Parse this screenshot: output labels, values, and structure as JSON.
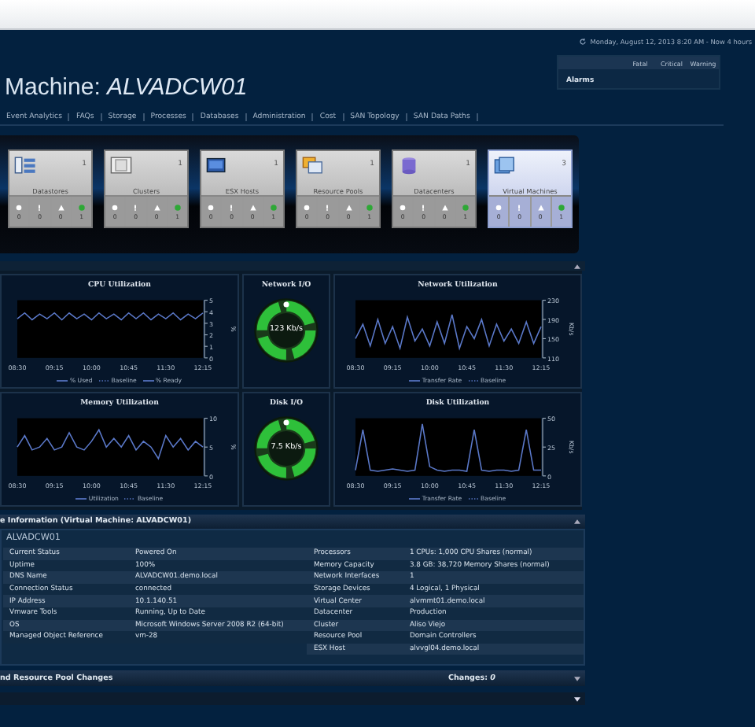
{
  "date_range": "Monday, August 12, 2013 8:20 AM - Now 4 hours",
  "title": {
    "prefix": "Machine:",
    "name": "ALVADCW01"
  },
  "alarms": {
    "columns": [
      "Fatal",
      "Critical",
      "Warning"
    ],
    "row_label": "Alarms"
  },
  "tabs": [
    {
      "label": "Event Analytics",
      "selected": false
    },
    {
      "label": "FAQs",
      "selected": false
    },
    {
      "label": "Storage",
      "selected": false
    },
    {
      "label": "Processes",
      "selected": false
    },
    {
      "label": "Databases",
      "selected": false
    },
    {
      "label": "Administration",
      "selected": false
    },
    {
      "label": "Cost",
      "selected": false
    },
    {
      "label": "SAN Topology",
      "selected": false
    },
    {
      "label": "SAN Data Paths",
      "selected": false
    }
  ],
  "tiles": [
    {
      "kind": "datastore",
      "label": "Datastores",
      "count": "1",
      "selected": false,
      "statuses": [
        "0",
        "0",
        "0",
        "1"
      ]
    },
    {
      "kind": "cluster",
      "label": "Clusters",
      "count": "1",
      "selected": false,
      "statuses": [
        "0",
        "0",
        "0",
        "1"
      ]
    },
    {
      "kind": "host",
      "label": "ESX Hosts",
      "count": "1",
      "selected": false,
      "statuses": [
        "0",
        "0",
        "0",
        "1"
      ]
    },
    {
      "kind": "pool",
      "label": "Resource Pools",
      "count": "1",
      "selected": false,
      "statuses": [
        "0",
        "0",
        "0",
        "1"
      ]
    },
    {
      "kind": "datacenter",
      "label": "Datacenters",
      "count": "1",
      "selected": false,
      "statuses": [
        "0",
        "0",
        "0",
        "1"
      ]
    },
    {
      "kind": "vm",
      "label": "Virtual Machines",
      "count": "3",
      "selected": true,
      "statuses": [
        "0",
        "0",
        "0",
        "1"
      ]
    }
  ],
  "panels": [
    {
      "kind": "chart",
      "chart_data": {
        "type": "line",
        "title": "CPU Utilization",
        "ylabel": "%",
        "ylim": [
          0,
          5
        ],
        "yticks": [
          0,
          1,
          2,
          3,
          4,
          5
        ],
        "categories": [
          "08:30",
          null,
          null,
          null,
          null,
          "09:15",
          null,
          null,
          null,
          null,
          "10:00",
          null,
          null,
          null,
          null,
          "10:45",
          null,
          null,
          null,
          null,
          "11:30",
          null,
          null,
          null,
          null,
          "12:15"
        ],
        "series": [
          {
            "name": "% Used",
            "color": "#5a78c8",
            "values": [
              3.4,
              3.9,
              3.3,
              3.8,
              3.4,
              3.9,
              3.3,
              3.9,
              3.4,
              3.8,
              3.3,
              3.9,
              3.4,
              3.8,
              3.3,
              3.9,
              3.4,
              3.9,
              3.3,
              3.8,
              3.4,
              3.9,
              3.3,
              3.8,
              3.4,
              3.9
            ]
          },
          {
            "name": "Baseline",
            "color": "#5a78c8",
            "values": [
              null,
              null,
              null,
              null,
              null,
              null,
              null,
              null,
              null,
              null,
              null,
              null,
              null,
              null,
              null,
              null,
              null,
              null,
              null,
              null,
              null,
              null,
              null,
              null,
              null,
              null
            ]
          },
          {
            "name": "% Ready",
            "color": "#5a78c8",
            "values": [
              null,
              null,
              null,
              null,
              null,
              null,
              null,
              null,
              null,
              null,
              null,
              null,
              null,
              null,
              null,
              null,
              null,
              null,
              null,
              null,
              null,
              null,
              null,
              null,
              null,
              null
            ]
          }
        ]
      }
    },
    {
      "kind": "gauge",
      "title": "Network I/O",
      "reading": "123 Kb/s"
    },
    {
      "kind": "chart",
      "chart_data": {
        "type": "line",
        "title": "Network Utilization",
        "ylabel": "Kb/s",
        "ylim": [
          110,
          230
        ],
        "yticks": [
          110,
          150,
          190,
          230
        ],
        "categories": [
          "08:30",
          null,
          null,
          null,
          null,
          "09:15",
          null,
          null,
          null,
          null,
          "10:00",
          null,
          null,
          null,
          null,
          "10:45",
          null,
          null,
          null,
          null,
          "11:30",
          null,
          null,
          null,
          null,
          "12:15"
        ],
        "series": [
          {
            "name": "Transfer Rate",
            "color": "#5a78c8",
            "values": [
              150,
              180,
              135,
              190,
              140,
              175,
              130,
              195,
              145,
              170,
              135,
              185,
              140,
              200,
              130,
              175,
              150,
              190,
              135,
              180,
              145,
              170,
              140,
              185,
              140,
              175
            ]
          },
          {
            "name": "Baseline",
            "color": "#5a78c8",
            "values": [
              null,
              null,
              null,
              null,
              null,
              null,
              null,
              null,
              null,
              null,
              null,
              null,
              null,
              null,
              null,
              null,
              null,
              null,
              null,
              null,
              null,
              null,
              null,
              null,
              null,
              null
            ]
          }
        ]
      }
    },
    {
      "kind": "chart",
      "chart_data": {
        "type": "line",
        "title": "Memory Utilization",
        "ylabel": "%",
        "ylim": [
          0,
          10
        ],
        "yticks": [
          0,
          5,
          10
        ],
        "categories": [
          "08:30",
          null,
          null,
          null,
          null,
          "09:15",
          null,
          null,
          null,
          null,
          "10:00",
          null,
          null,
          null,
          null,
          "10:45",
          null,
          null,
          null,
          null,
          "11:30",
          null,
          null,
          null,
          null,
          "12:15"
        ],
        "series": [
          {
            "name": "Utilization",
            "color": "#5a78c8",
            "values": [
              5,
              7,
              4.5,
              5,
              6.5,
              4.5,
              5,
              7.5,
              5,
              4.5,
              6,
              8,
              5,
              6.5,
              5,
              7,
              4.5,
              6,
              5,
              3,
              7,
              5,
              6.5,
              4.5,
              6,
              5
            ]
          },
          {
            "name": "Baseline",
            "color": "#5a78c8",
            "values": [
              null,
              null,
              null,
              null,
              null,
              null,
              null,
              null,
              null,
              null,
              null,
              null,
              null,
              null,
              null,
              null,
              null,
              null,
              null,
              null,
              null,
              null,
              null,
              null,
              null,
              null
            ]
          }
        ]
      }
    },
    {
      "kind": "gauge",
      "title": "Disk I/O",
      "reading": "7.5 Kb/s"
    },
    {
      "kind": "chart",
      "chart_data": {
        "type": "line",
        "title": "Disk Utilization",
        "ylabel": "Kb/s",
        "ylim": [
          0,
          50
        ],
        "yticks": [
          0,
          25,
          50
        ],
        "categories": [
          "08:30",
          null,
          null,
          null,
          null,
          "09:15",
          null,
          null,
          null,
          null,
          "10:00",
          null,
          null,
          null,
          null,
          "10:45",
          null,
          null,
          null,
          null,
          "11:30",
          null,
          null,
          null,
          null,
          "12:15"
        ],
        "series": [
          {
            "name": "Transfer Rate",
            "color": "#5a78c8",
            "values": [
              5,
              40,
              5,
              4,
              5,
              6,
              5,
              4,
              5,
              45,
              8,
              5,
              4,
              5,
              5,
              4,
              40,
              5,
              4,
              5,
              5,
              4,
              5,
              40,
              5,
              5
            ]
          },
          {
            "name": "Baseline",
            "color": "#5a78c8",
            "values": [
              null,
              null,
              null,
              null,
              null,
              null,
              null,
              null,
              null,
              null,
              null,
              null,
              null,
              null,
              null,
              null,
              null,
              null,
              null,
              null,
              null,
              null,
              null,
              null,
              null,
              null
            ]
          }
        ]
      }
    }
  ],
  "info": {
    "header": "e Information (Virtual Machine: ALVADCW01)",
    "name": "ALVADCW01",
    "left": [
      {
        "label": "Current Status",
        "value": "Powered On"
      },
      {
        "label": "Uptime",
        "value": "100%"
      },
      {
        "label": "DNS Name",
        "value": "ALVADCW01.demo.local"
      },
      {
        "label": "Connection Status",
        "value": "connected"
      },
      {
        "label": "IP Address",
        "value": "10.1.140.51"
      },
      {
        "label": "Vmware Tools",
        "value": "Running, Up to Date"
      },
      {
        "label": "OS",
        "value": "Microsoft Windows Server 2008 R2 (64-bit)"
      },
      {
        "label": "Managed Object Reference",
        "value": "vm-28"
      }
    ],
    "right": [
      {
        "label": "Processors",
        "value": "1 CPUs: 1,000 CPU Shares (normal)"
      },
      {
        "label": "Memory Capacity",
        "value": "3.8 GB: 38,720 Memory Shares (normal)"
      },
      {
        "label": "Network Interfaces",
        "value": "1"
      },
      {
        "label": "Storage Devices",
        "value": "4 Logical, 1 Physical"
      },
      {
        "label": "Virtual Center",
        "value": "alvmmt01.demo.local"
      },
      {
        "label": "Datacenter",
        "value": "Production"
      },
      {
        "label": "Cluster",
        "value": "Aliso Viejo"
      },
      {
        "label": "Resource Pool",
        "value": "Domain Controllers"
      },
      {
        "label": "ESX Host",
        "value": "alvvgl04.demo.local"
      }
    ]
  },
  "changes": {
    "title": "nd Resource Pool Changes",
    "label": "Changes:",
    "count": "0"
  }
}
